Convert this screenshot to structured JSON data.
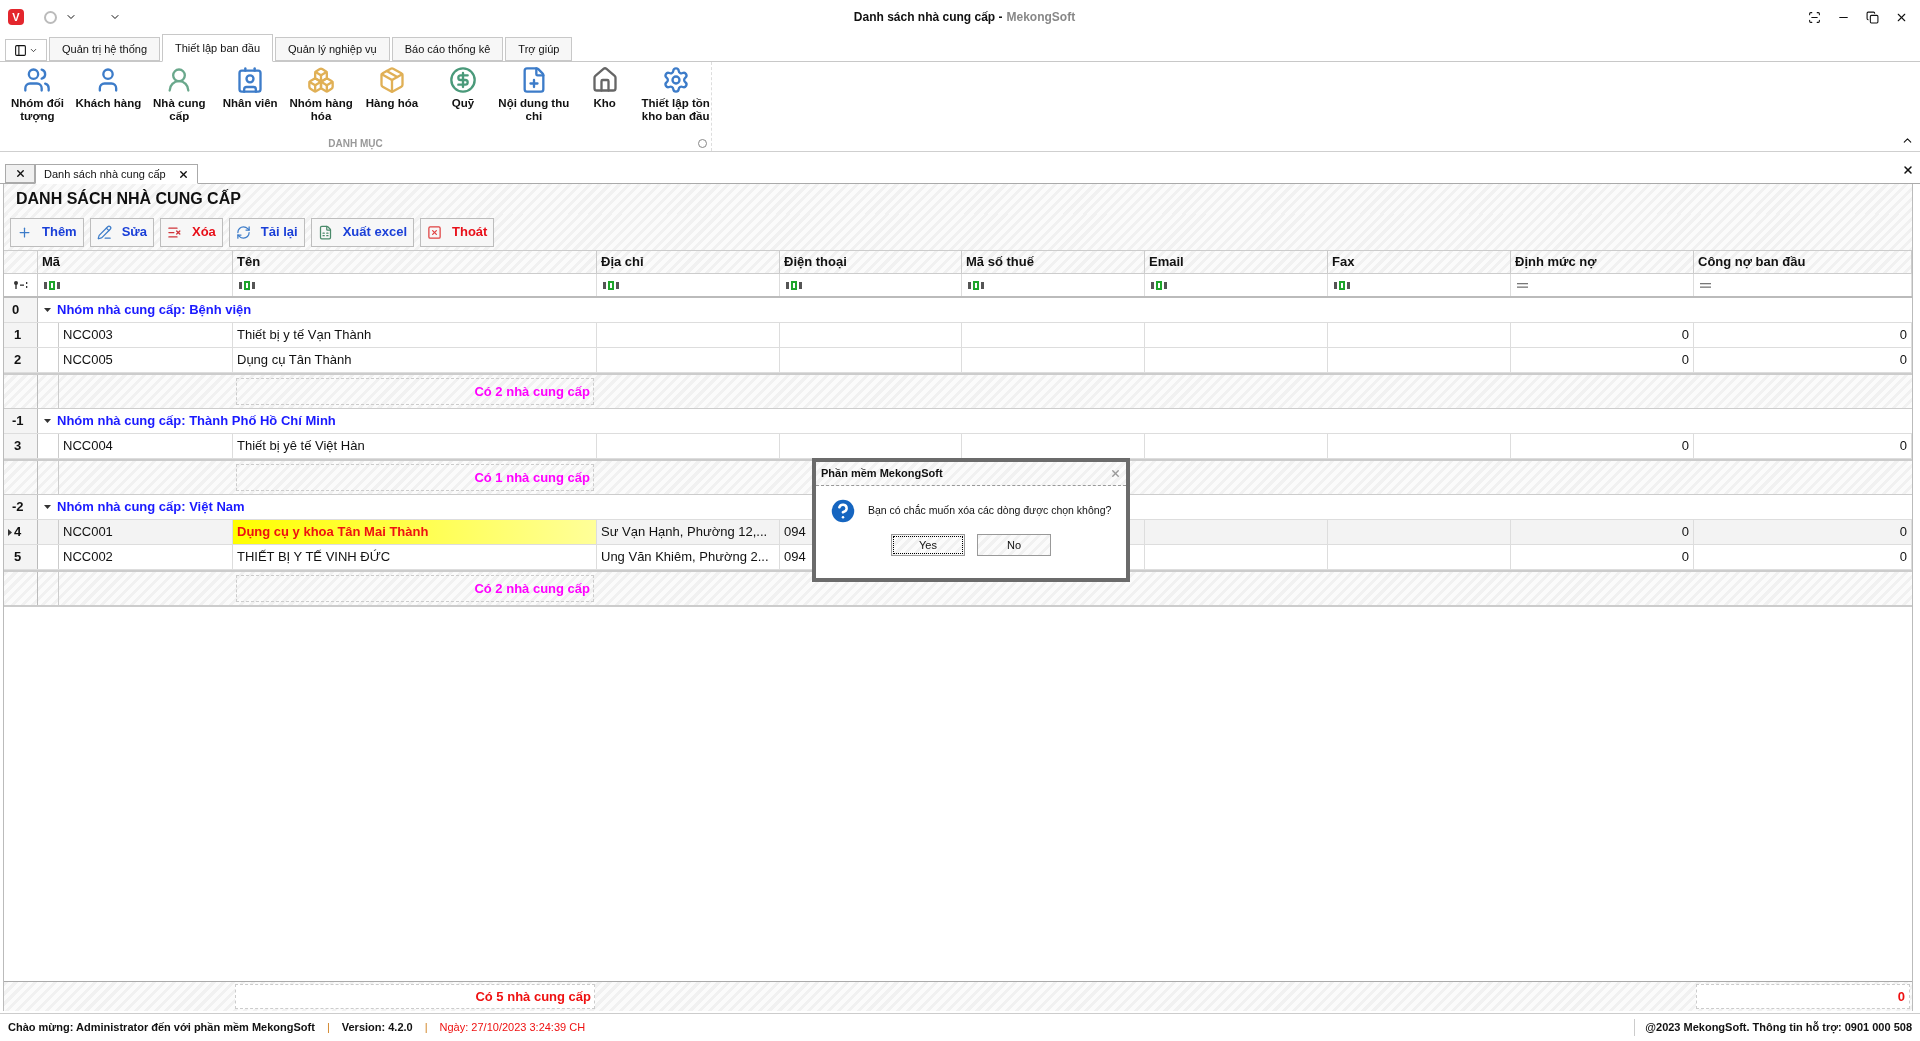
{
  "window": {
    "logo_letter": "V",
    "title": "Danh sách nhà cung cấp -",
    "app": "MekongSoft"
  },
  "ribbon_tabs": [
    {
      "label": "Quản trị hệ thống",
      "selected": false
    },
    {
      "label": "Thiết lập ban đầu",
      "selected": true
    },
    {
      "label": "Quản lý nghiệp vụ",
      "selected": false
    },
    {
      "label": "Báo cáo thống kê",
      "selected": false
    },
    {
      "label": "Trợ giúp",
      "selected": false
    }
  ],
  "ribbon": {
    "group": "DANH MỤC",
    "items": [
      {
        "label": "Nhóm đối tượng"
      },
      {
        "label": "Khách hàng"
      },
      {
        "label": "Nhà cung cấp"
      },
      {
        "label": "Nhân viên"
      },
      {
        "label": "Nhóm hàng hóa"
      },
      {
        "label": "Hàng hóa"
      },
      {
        "label": "Quỹ"
      },
      {
        "label": "Nội dung thu chi"
      },
      {
        "label": "Kho"
      },
      {
        "label": "Thiết lập tồn kho ban đầu"
      }
    ]
  },
  "document_tabs": [
    {
      "label": "Danh sách nhà cung cấp",
      "selected": true
    }
  ],
  "page_title": "DANH SÁCH NHÀ CUNG CẤP",
  "toolbar": [
    {
      "label": "Thêm",
      "kind": "add"
    },
    {
      "label": "Sửa",
      "kind": "edit"
    },
    {
      "label": "Xóa",
      "kind": "delete"
    },
    {
      "label": "Tải lại",
      "kind": "reload"
    },
    {
      "label": "Xuất excel",
      "kind": "export"
    },
    {
      "label": "Thoát",
      "kind": "exit"
    }
  ],
  "table": {
    "columns": [
      {
        "label": "Mã",
        "kind": "text"
      },
      {
        "label": "Tên",
        "kind": "text"
      },
      {
        "label": "Địa chỉ",
        "kind": "text"
      },
      {
        "label": "Điện thoại",
        "kind": "text"
      },
      {
        "label": "Mã số thuế",
        "kind": "text"
      },
      {
        "label": "Email",
        "kind": "text"
      },
      {
        "label": "Fax",
        "kind": "text"
      },
      {
        "label": "Định mức nợ",
        "kind": "number"
      },
      {
        "label": "Công nợ ban đầu",
        "kind": "number"
      }
    ],
    "groups": [
      {
        "index": "0",
        "label": "Nhóm nhà cung cấp: Bệnh viện",
        "expanded": true,
        "summary": "Có 2 nhà cung cấp",
        "rows": [
          {
            "index": "1",
            "selected": false,
            "code": "NCC003",
            "name": "Thiết bị y tế Vạn Thành",
            "limit": "0",
            "opening_debt": "0"
          },
          {
            "index": "2",
            "selected": false,
            "code": "NCC005",
            "name": "Dụng cụ Tân Thành",
            "limit": "0",
            "opening_debt": "0"
          }
        ]
      },
      {
        "index": "-1",
        "label": "Nhóm nhà cung cấp: Thành Phố Hồ Chí Minh",
        "expanded": true,
        "summary": "Có 1 nhà cung cấp",
        "rows": [
          {
            "index": "3",
            "selected": false,
            "code": "NCC004",
            "name": "Thiết bị yê tế Việt Hàn",
            "limit": "0",
            "opening_debt": "0"
          }
        ]
      },
      {
        "index": "-2",
        "label": "Nhóm nhà cung cấp: Việt Nam",
        "expanded": true,
        "summary": "Có 2 nhà cung cấp",
        "rows": [
          {
            "index": "4",
            "selected": true,
            "code": "NCC001",
            "name": "Dụng cụ y khoa Tân Mai Thành",
            "address": "Sư Vạn Hạnh, Phường 12,...",
            "phone": "094",
            "limit": "0",
            "opening_debt": "0"
          },
          {
            "index": "5",
            "selected": false,
            "code": "NCC002",
            "name": "THIẾT BỊ Y TẾ VINH ĐỨC",
            "address": "Ung Văn Khiêm, Phường 2...",
            "phone": "094",
            "limit": "0",
            "opening_debt": "0"
          }
        ]
      }
    ],
    "total": {
      "summary": "Có 5 nhà cung cấp",
      "opening_debt": "0"
    }
  },
  "dialog": {
    "title": "Phần mềm MekongSoft",
    "message": "Bạn có chắc muốn xóa các dòng được chọn không?",
    "buttons": [
      {
        "label": "Yes",
        "focused": true
      },
      {
        "label": "No",
        "focused": false
      }
    ]
  },
  "status_bar": {
    "items": [
      {
        "text": "Chào mừng: Administrator đến với phần mềm MekongSoft",
        "kind": "info"
      },
      {
        "text": "|",
        "kind": "separator"
      },
      {
        "text": "Version: 4.2.0",
        "kind": "info"
      },
      {
        "text": "|",
        "kind": "separator"
      },
      {
        "text": "Ngày: 27/10/2023 3:24:39 CH",
        "kind": "date"
      }
    ],
    "right": "@2023 MekongSoft. Thông tin hỗ trợ: 0901 000 508"
  }
}
